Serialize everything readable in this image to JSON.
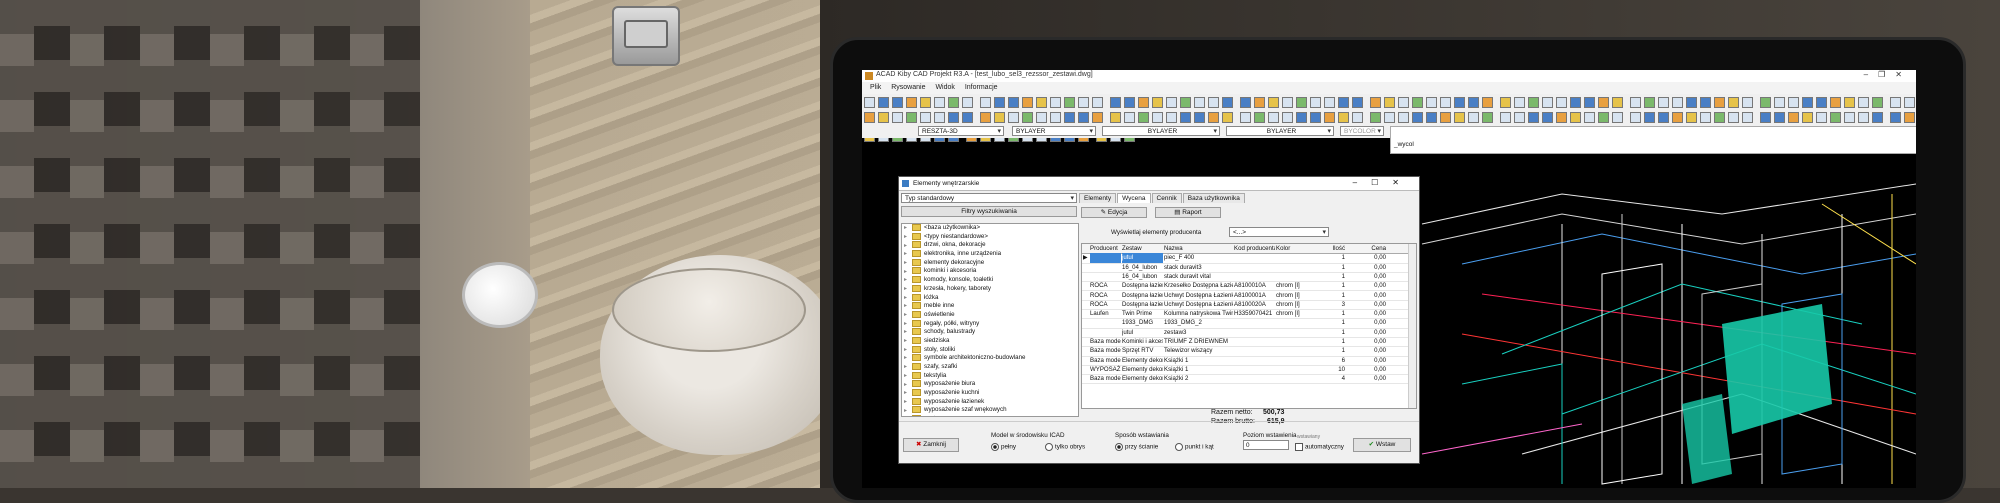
{
  "window": {
    "title": "ACAD Kiby CAD Projekt R3.A - [test_lubo_sel3_rezssor_zestawi.dwg]",
    "controls": [
      "–",
      "❐",
      "✕"
    ]
  },
  "menu": [
    "Plik",
    "Rysowanie",
    "Widok",
    "Informacje"
  ],
  "properties_bar": {
    "layer": "RESZTA-3D",
    "color": "BYLAYER",
    "linetype": "BYLAYER",
    "lineweight": "BYLAYER",
    "plotstyle": "BYCOLOR"
  },
  "command_line": {
    "history": "",
    "prompt": "_wycol"
  },
  "dialog": {
    "title": "Elementy wnętrzarskie",
    "controls": [
      "–",
      "☐",
      "✕"
    ],
    "type_select": "Typ standardowy",
    "filters_button": "Filtry wyszukiwania",
    "tree_items": [
      "<baza użytkownika>",
      "<typy niestandardowe>",
      "drzwi, okna, dekoracje",
      "elektronika, inne urządzenia",
      "elementy dekoracyjne",
      "kominki i akcesoria",
      "komody, konsole, toaletki",
      "krzesła, hokery, taborety",
      "łóżka",
      "meble inne",
      "oświetlenie",
      "regały, półki, witryny",
      "schody, balustrady",
      "siedziska",
      "stoły, stoliki",
      "symbole architektoniczno-budowlane",
      "szafy, szafki",
      "tekstylia",
      "wyposażenie biura",
      "wyposażenie kuchni",
      "wyposażenie łazienek",
      "wyposażenie szaf wnękowych",
      "zestawy"
    ],
    "tabs": [
      "Elementy",
      "Wycena",
      "Cennik",
      "Baza użytkownika"
    ],
    "active_tab": "Wycena",
    "edit_button": "Edycja",
    "report_button": "Raport",
    "producer_filter_label": "Wyświetlaj elementy producenta",
    "producer_filter_value": "<...>",
    "columns": [
      "Producent",
      "Zestaw",
      "Nazwa",
      "Kod producenta",
      "Kolor",
      "Ilość",
      "Cena"
    ],
    "rows": [
      [
        "",
        "jutul",
        "piec_F 400",
        "",
        "",
        "1",
        "0,00"
      ],
      [
        "",
        "16_04_lubon",
        "stack duravit3",
        "",
        "",
        "1",
        "0,00"
      ],
      [
        "",
        "16_04_lubon",
        "stack duravit vital",
        "",
        "",
        "1",
        "0,00"
      ],
      [
        "ROCA",
        "Dostępna łazienka",
        "Krzesełko Dostępna Łazienka",
        "A8100010A",
        "chrom [I]",
        "1",
        "0,00"
      ],
      [
        "ROCA",
        "Dostępna łazienka",
        "Uchwyt Dostępna Łazienka",
        "A8100001A",
        "chrom [I]",
        "1",
        "0,00"
      ],
      [
        "ROCA",
        "Dostępna łazienka",
        "Uchwyt Dostępna Łazienka",
        "A8100020A",
        "chrom [I]",
        "3",
        "0,00"
      ],
      [
        "Laufen",
        "Twin Prime",
        "Kolumna natryskowa Twin Prime",
        "H3359070421",
        "chrom [I]",
        "1",
        "0,00"
      ],
      [
        "",
        "1933_DMG",
        "1933_DMG_2",
        "",
        "",
        "1",
        "0,00"
      ],
      [
        "",
        "jutul",
        "zestaw3",
        "",
        "",
        "1",
        "0,00"
      ],
      [
        "Baza modeli 3d",
        "Kominki i akcesoria",
        "TRIUMF Z DRIEWNEM",
        "",
        "",
        "1",
        "0,00"
      ],
      [
        "Baza modeli 3d",
        "Sprzęt RTV",
        "Telewizor wiszący",
        "",
        "",
        "1",
        "0,00"
      ],
      [
        "Baza modeli 3d",
        "Elementy dekoracyjne",
        "Książki 1",
        "",
        "",
        "6",
        "0,00"
      ],
      [
        "WYPOSAŻENIE",
        "Elementy dekoracyjne",
        "Książki 1",
        "",
        "",
        "10",
        "0,00"
      ],
      [
        "Baza modeli 3d",
        "Elementy dekoracyjne",
        "Książki 2",
        "",
        "",
        "4",
        "0,00"
      ]
    ],
    "selected_row": 0,
    "net_label": "Razem netto:",
    "net_value": "500,73",
    "gross_label": "Razem brutto:",
    "gross_value": "615,9",
    "close_button": "Zamknij",
    "model_env_label": "Model w środowisku ICAD",
    "model_opt1": "pełny",
    "model_opt2": "tylko obrys",
    "insert_label": "Sposób wstawiania",
    "insert_opt1": "przy ścianie",
    "insert_opt2": "punkt i kąt",
    "level_label": "Poziom wstawienia",
    "level_value": "0",
    "auto_label": "automatyczny",
    "auto_small": "wstawiany",
    "insert_button": "Wstaw"
  }
}
